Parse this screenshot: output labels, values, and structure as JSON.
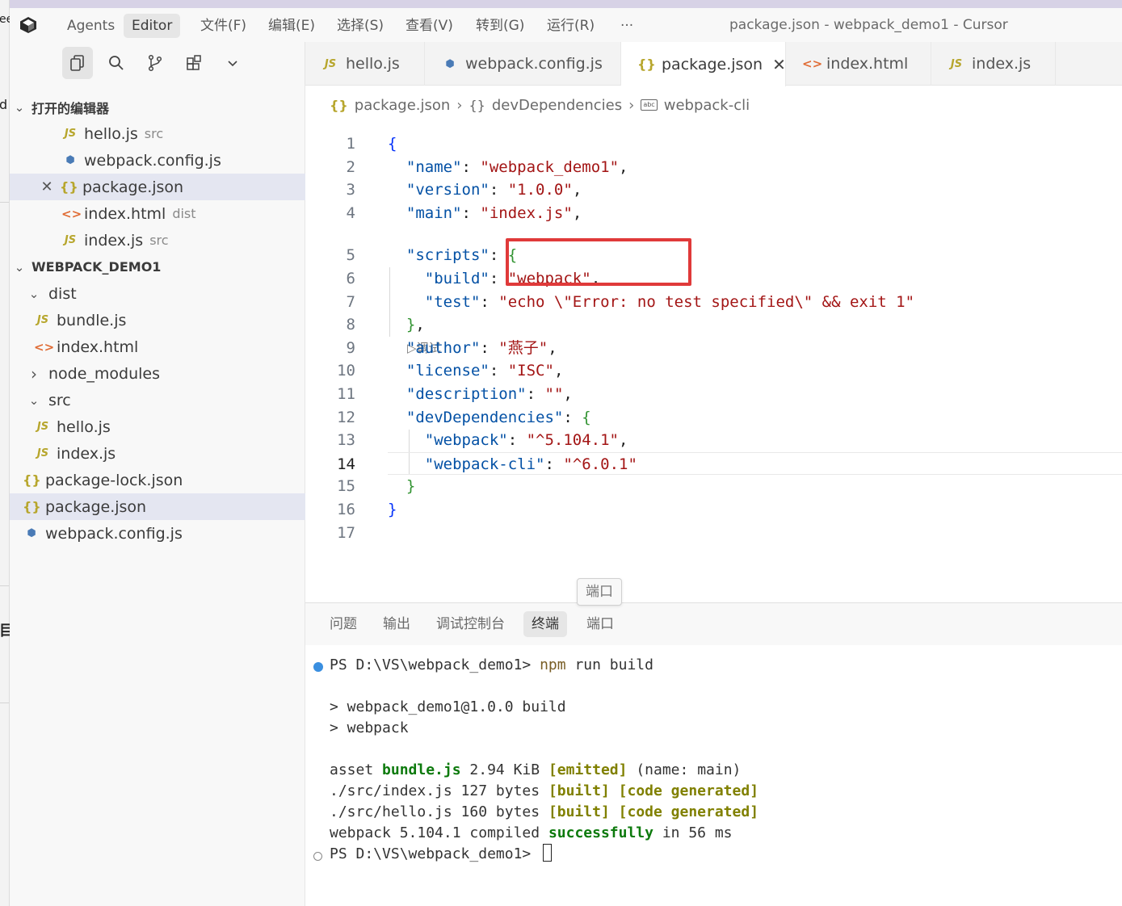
{
  "titlebar": {
    "modes": [
      "Agents",
      "Editor"
    ],
    "menus": [
      "文件(F)",
      "编辑(E)",
      "选择(S)",
      "查看(V)",
      "转到(G)",
      "运行(R)"
    ],
    "more": "···",
    "window_title": "package.json - webpack_demo1 - Cursor"
  },
  "background_fragments": [
    "ee",
    "d",
    "目"
  ],
  "sidebar": {
    "activity_icons": [
      "explorer-icon",
      "search-icon",
      "source-control-icon",
      "extensions-icon",
      "chevron-down-icon"
    ],
    "open_editors": {
      "title": "打开的编辑器",
      "items": [
        {
          "name": "hello.js",
          "hint": "src",
          "icon": "js"
        },
        {
          "name": "webpack.config.js",
          "hint": "",
          "icon": "cube"
        },
        {
          "name": "package.json",
          "hint": "",
          "icon": "json"
        },
        {
          "name": "index.html",
          "hint": "dist",
          "icon": "html"
        },
        {
          "name": "index.js",
          "hint": "src",
          "icon": "js"
        }
      ]
    },
    "project": {
      "title": "WEBPACK_DEMO1",
      "items": [
        {
          "name": "dist",
          "type": "folder-open"
        },
        {
          "name": "bundle.js",
          "type": "js"
        },
        {
          "name": "index.html",
          "type": "html"
        },
        {
          "name": "node_modules",
          "type": "folder-closed"
        },
        {
          "name": "src",
          "type": "folder-open"
        },
        {
          "name": "hello.js",
          "type": "js"
        },
        {
          "name": "index.js",
          "type": "js"
        },
        {
          "name": "package-lock.json",
          "type": "json"
        },
        {
          "name": "package.json",
          "type": "json"
        },
        {
          "name": "webpack.config.js",
          "type": "cube"
        }
      ]
    }
  },
  "icons": {
    "js": "JS",
    "json": "{}",
    "html": "<>",
    "cube": "⬢",
    "chev_down": "⌄",
    "chev_right": "›",
    "close": "✕"
  },
  "tabs": [
    {
      "label": "hello.js",
      "icon": "js"
    },
    {
      "label": "webpack.config.js",
      "icon": "cube"
    },
    {
      "label": "package.json",
      "icon": "json",
      "active": true
    },
    {
      "label": "index.html",
      "icon": "html"
    },
    {
      "label": "index.js",
      "icon": "js"
    }
  ],
  "breadcrumb": [
    "package.json",
    "devDependencies",
    "webpack-cli"
  ],
  "editor": {
    "current_line": 14,
    "codelens": "▷调试",
    "lines": [
      [
        [
          "br1",
          "{"
        ]
      ],
      [
        [
          "pun",
          "  "
        ],
        [
          "key",
          "\"name\""
        ],
        [
          "pun",
          ": "
        ],
        [
          "str",
          "\"webpack_demo1\""
        ],
        [
          "pun",
          ","
        ]
      ],
      [
        [
          "pun",
          "  "
        ],
        [
          "key",
          "\"version\""
        ],
        [
          "pun",
          ": "
        ],
        [
          "str",
          "\"1.0.0\""
        ],
        [
          "pun",
          ","
        ]
      ],
      [
        [
          "pun",
          "  "
        ],
        [
          "key",
          "\"main\""
        ],
        [
          "pun",
          ": "
        ],
        [
          "str",
          "\"index.js\""
        ],
        [
          "pun",
          ","
        ]
      ],
      [
        [
          "pun",
          "  "
        ],
        [
          "key",
          "\"scripts\""
        ],
        [
          "pun",
          ": "
        ],
        [
          "br2",
          "{"
        ]
      ],
      [
        [
          "pun",
          "    "
        ],
        [
          "key",
          "\"build\""
        ],
        [
          "pun",
          ": "
        ],
        [
          "str",
          "\"webpack\""
        ],
        [
          "pun",
          ","
        ]
      ],
      [
        [
          "pun",
          "    "
        ],
        [
          "key",
          "\"test\""
        ],
        [
          "pun",
          ": "
        ],
        [
          "str",
          "\"echo \\\"Error: no test specified\\\" && exit 1\""
        ]
      ],
      [
        [
          "pun",
          "  "
        ],
        [
          "br2",
          "}"
        ],
        [
          "pun",
          ","
        ]
      ],
      [
        [
          "pun",
          "  "
        ],
        [
          "key",
          "\"author\""
        ],
        [
          "pun",
          ": "
        ],
        [
          "str",
          "\"燕子\""
        ],
        [
          "pun",
          ","
        ]
      ],
      [
        [
          "pun",
          "  "
        ],
        [
          "key",
          "\"license\""
        ],
        [
          "pun",
          ": "
        ],
        [
          "str",
          "\"ISC\""
        ],
        [
          "pun",
          ","
        ]
      ],
      [
        [
          "pun",
          "  "
        ],
        [
          "key",
          "\"description\""
        ],
        [
          "pun",
          ": "
        ],
        [
          "str",
          "\"\""
        ],
        [
          "pun",
          ","
        ]
      ],
      [
        [
          "pun",
          "  "
        ],
        [
          "key",
          "\"devDependencies\""
        ],
        [
          "pun",
          ": "
        ],
        [
          "br2",
          "{"
        ]
      ],
      [
        [
          "pun",
          "    "
        ],
        [
          "key",
          "\"webpack\""
        ],
        [
          "pun",
          ": "
        ],
        [
          "str",
          "\"^5.104.1\""
        ],
        [
          "pun",
          ","
        ]
      ],
      [
        [
          "pun",
          "    "
        ],
        [
          "key",
          "\"webpack-cli\""
        ],
        [
          "pun",
          ": "
        ],
        [
          "str",
          "\"^6.0.1\""
        ]
      ],
      [
        [
          "pun",
          "  "
        ],
        [
          "br2",
          "}"
        ]
      ],
      [
        [
          "br1",
          "}"
        ]
      ],
      []
    ]
  },
  "panel": {
    "tooltip": "端口",
    "tabs": [
      "问题",
      "输出",
      "调试控制台",
      "终端",
      "端口"
    ],
    "active_tab": "终端",
    "terminal_lines": [
      [
        [
          "n",
          "PS D:\\VS\\webpack_demo1> "
        ],
        [
          "cmd",
          "npm"
        ],
        [
          "n",
          " run build"
        ]
      ],
      [],
      [
        [
          "n",
          "> webpack_demo1@1.0.0 build"
        ]
      ],
      [
        [
          "n",
          "> webpack"
        ]
      ],
      [],
      [
        [
          "n",
          "asset "
        ],
        [
          "green",
          "bundle.js"
        ],
        [
          "n",
          " 2.94 KiB "
        ],
        [
          "olive",
          "[emitted]"
        ],
        [
          "n",
          " (name: main)"
        ]
      ],
      [
        [
          "n",
          "./src/index.js 127 bytes "
        ],
        [
          "olive",
          "[built]"
        ],
        [
          "n",
          " "
        ],
        [
          "olive",
          "[code generated]"
        ]
      ],
      [
        [
          "n",
          "./src/hello.js 160 bytes "
        ],
        [
          "olive",
          "[built]"
        ],
        [
          "n",
          " "
        ],
        [
          "olive",
          "[code generated]"
        ]
      ],
      [
        [
          "n",
          "webpack 5.104.1 compiled "
        ],
        [
          "green",
          "successfully"
        ],
        [
          "n",
          " in 56 ms"
        ]
      ],
      [
        [
          "n",
          "PS D:\\VS\\webpack_demo1> "
        ]
      ]
    ]
  }
}
